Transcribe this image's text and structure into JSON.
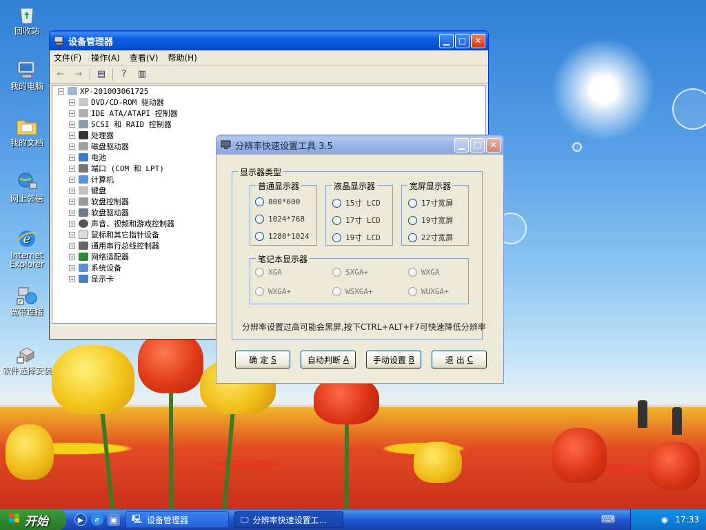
{
  "desktop": {
    "icons": [
      {
        "label": "回收站",
        "icon": "recycle-bin-icon"
      },
      {
        "label": "我的电脑",
        "icon": "my-computer-icon"
      },
      {
        "label": "我的文档",
        "icon": "my-documents-icon"
      },
      {
        "label": "网上邻居",
        "icon": "network-places-icon"
      },
      {
        "label": "Internet Explorer",
        "icon": "ie-icon"
      },
      {
        "label": "宽带连接",
        "icon": "broadband-icon"
      },
      {
        "label": "软件选择安装",
        "icon": "software-install-icon"
      }
    ]
  },
  "devmgr": {
    "title": "设备管理器",
    "menu": [
      "文件(F)",
      "操作(A)",
      "查看(V)",
      "帮助(H)"
    ],
    "root": "XP-201003061725",
    "items": [
      "DVD/CD-ROM 驱动器",
      "IDE ATA/ATAPI 控制器",
      "SCSI 和 RAID 控制器",
      "处理器",
      "磁盘驱动器",
      "电池",
      "端口 (COM 和 LPT)",
      "计算机",
      "键盘",
      "软盘控制器",
      "软盘驱动器",
      "声音、视频和游戏控制器",
      "鼠标和其它指针设备",
      "通用串行总线控制器",
      "网络适配器",
      "系统设备",
      "显示卡"
    ]
  },
  "reswin": {
    "title": "分辨率快速设置工具 3.5",
    "outer_group": "显示器类型",
    "group_normal": "普通显示器",
    "normal": [
      "800*600",
      "1024*768",
      "1280*1024"
    ],
    "group_lcd": "液晶显示器",
    "lcd": [
      "15寸 LCD",
      "17寸 LCD",
      "19寸 LCD"
    ],
    "group_wide": "宽屏显示器",
    "wide": [
      "17寸宽屏",
      "19寸宽屏",
      "22寸宽屏"
    ],
    "group_laptop": "笔记本显示器",
    "laptop": [
      "XGA",
      "SXGA+",
      "WXGA",
      "WXGA+",
      "WSXGA+",
      "WUXGA+"
    ],
    "note": "分辨率设置过高可能会黑屏,按下CTRL+ALT+F7可快速降低分辨率",
    "buttons": [
      {
        "label": "确 定",
        "key": "S"
      },
      {
        "label": "自动判断",
        "key": "A"
      },
      {
        "label": "手动设置",
        "key": "B"
      },
      {
        "label": "退 出",
        "key": "C"
      }
    ]
  },
  "taskbar": {
    "start": "开始",
    "tasks": [
      "设备管理器",
      "分辨率快速设置工..."
    ],
    "clock": "17:33"
  },
  "colors": {
    "titlebar": "#0b5fe0",
    "taskbar": "#2157d7",
    "start": "#2f8a2f",
    "window_bg": "#ece9d8"
  }
}
